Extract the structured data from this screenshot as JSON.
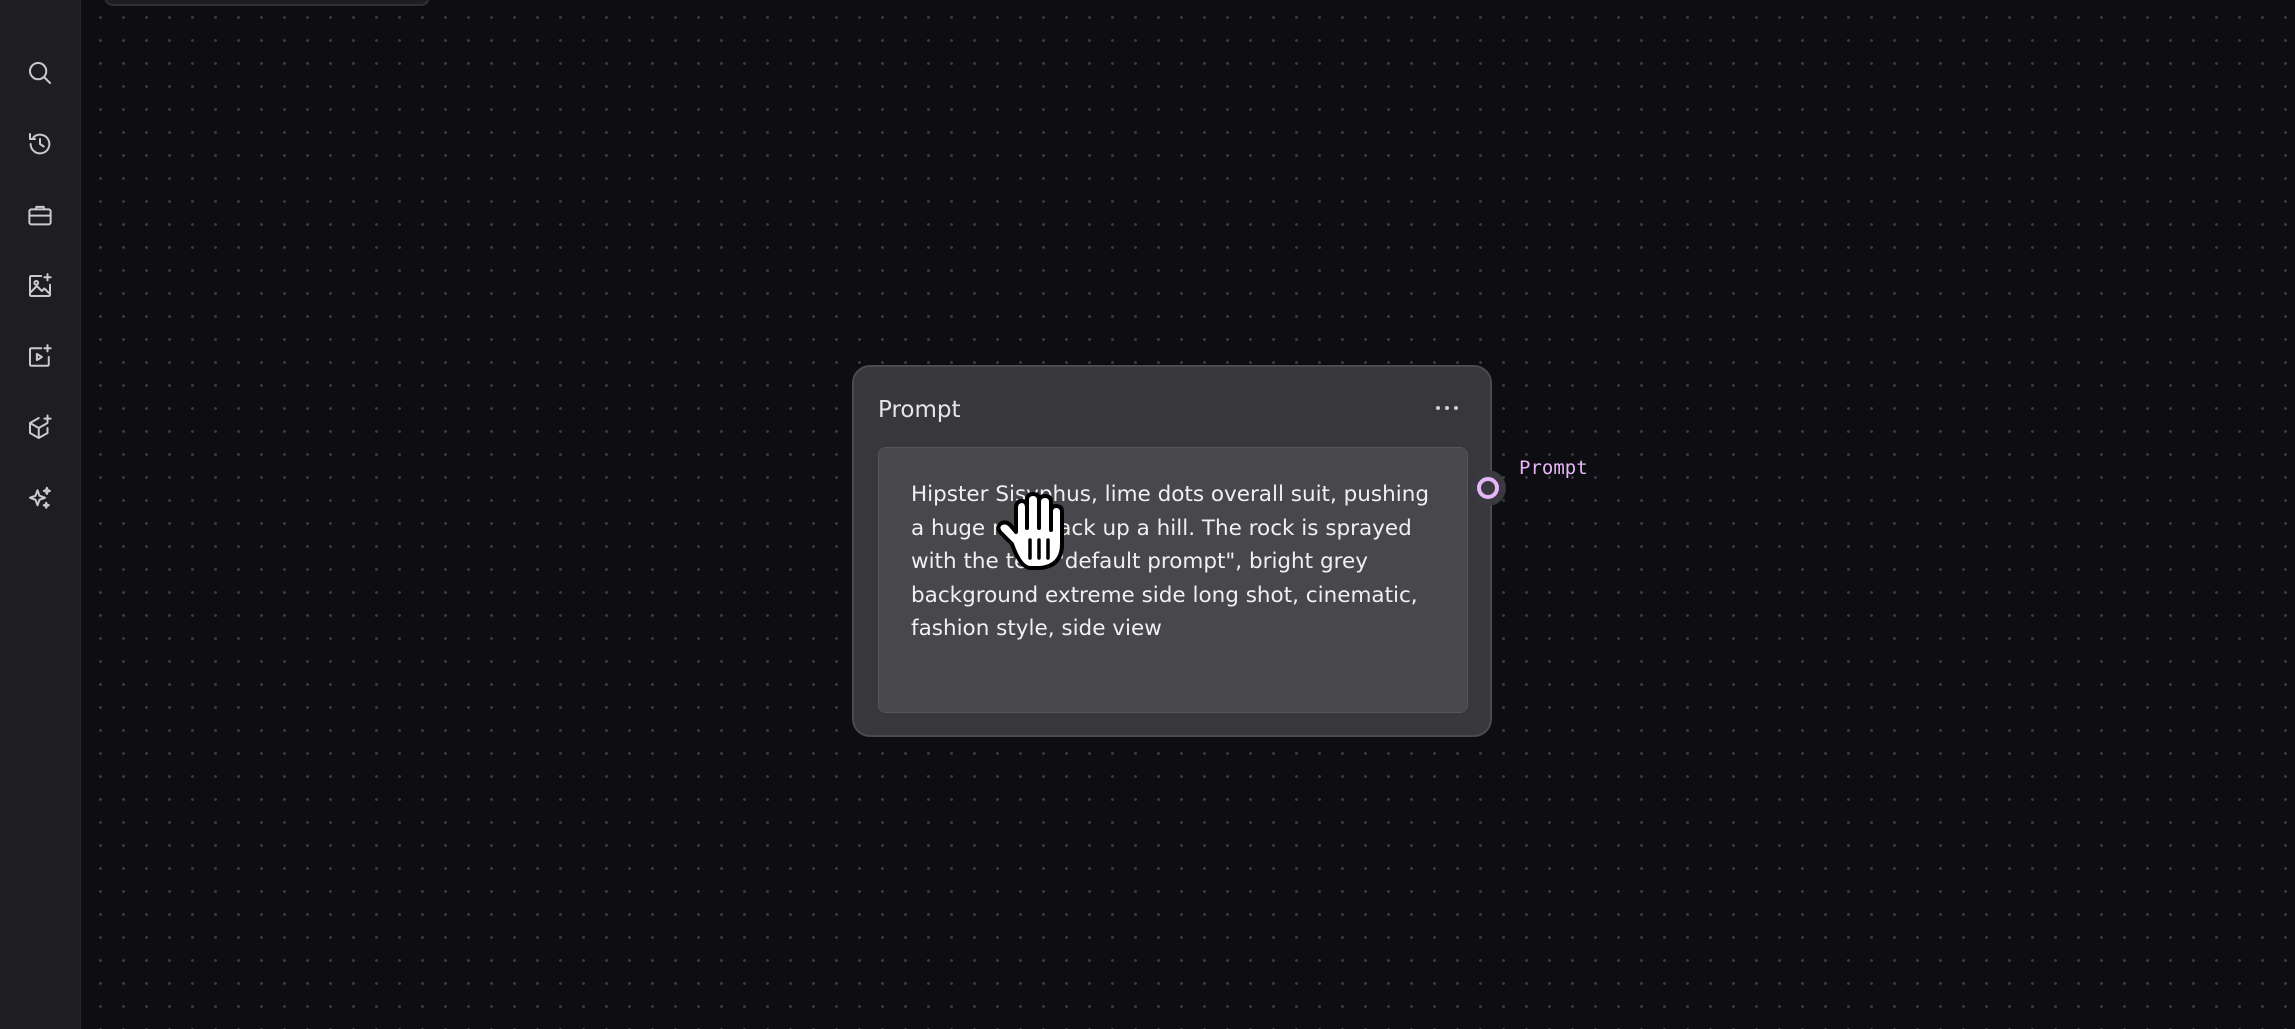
{
  "sidebar": {
    "items": [
      {
        "icon": "search-icon"
      },
      {
        "icon": "history-icon"
      },
      {
        "icon": "toolbox-icon"
      },
      {
        "icon": "image-generate-icon"
      },
      {
        "icon": "video-generate-icon"
      },
      {
        "icon": "3d-generate-icon"
      },
      {
        "icon": "sparkle-icon"
      }
    ]
  },
  "node": {
    "title": "Prompt",
    "prompt_text": "Hipster Sisyphus, lime dots overall suit, pushing a huge rock back up a hill. The rock is sprayed with the text \"default prompt\", bright grey background extreme side long shot, cinematic, fashion style, side view",
    "output_port_label": "Prompt"
  },
  "colors": {
    "accent": "#e7b6f7",
    "canvas_bg": "#0d0d12",
    "node_bg": "#38373c"
  },
  "cursor": {
    "icon": "grab-hand-cursor-icon"
  }
}
